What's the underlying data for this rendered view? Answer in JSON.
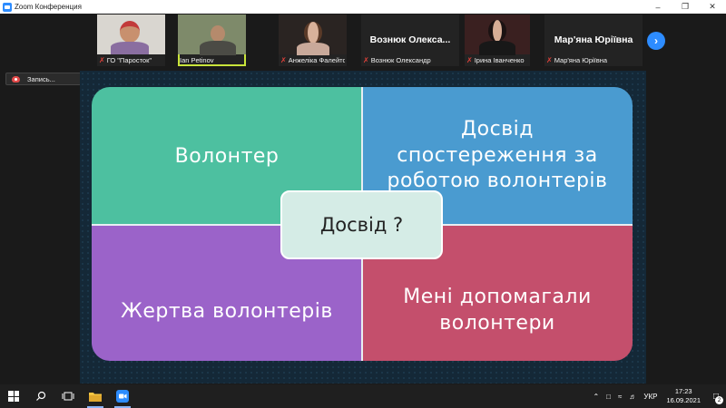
{
  "window": {
    "title": "Zoom Конференция",
    "controls": [
      "minimize-icon",
      "restore-icon",
      "close-icon"
    ]
  },
  "participants": [
    {
      "name": "ГО \"Паросток\"",
      "muted": true,
      "video": true
    },
    {
      "name": "Ian Petinov",
      "muted": false,
      "video": true,
      "active_speaker": true
    },
    {
      "name": "Анжеліка Фалейтор",
      "muted": true,
      "video": true
    },
    {
      "name": "Вознюк Олександр",
      "muted": true,
      "video": false,
      "display_name": "Вознюк Олекса..."
    },
    {
      "name": "Ірина Іванченко",
      "muted": true,
      "video": true
    },
    {
      "name": "Мар'яна Юріївна",
      "muted": true,
      "video": false,
      "display_name": "Мар'яна Юріївна"
    }
  ],
  "recording": {
    "label": "Запись..."
  },
  "slide": {
    "top_left": "Волонтер",
    "top_right": "Досвід спостереження за роботою волонтерів",
    "bottom_left": "Жертва волонтерів",
    "bottom_right": "Мені допомагали волонтери",
    "center": "Досвід ?"
  },
  "taskbar": {
    "language": "УКР",
    "time": "17:23",
    "date": "16.09.2021",
    "notifications": "2"
  },
  "colors": {
    "zoom_blue": "#2d8cff",
    "active_border": "#c9e43a",
    "teal": "#4dc0a0",
    "blue": "#4a9bd0",
    "purple": "#9b63c9",
    "rose": "#c44f6c"
  }
}
